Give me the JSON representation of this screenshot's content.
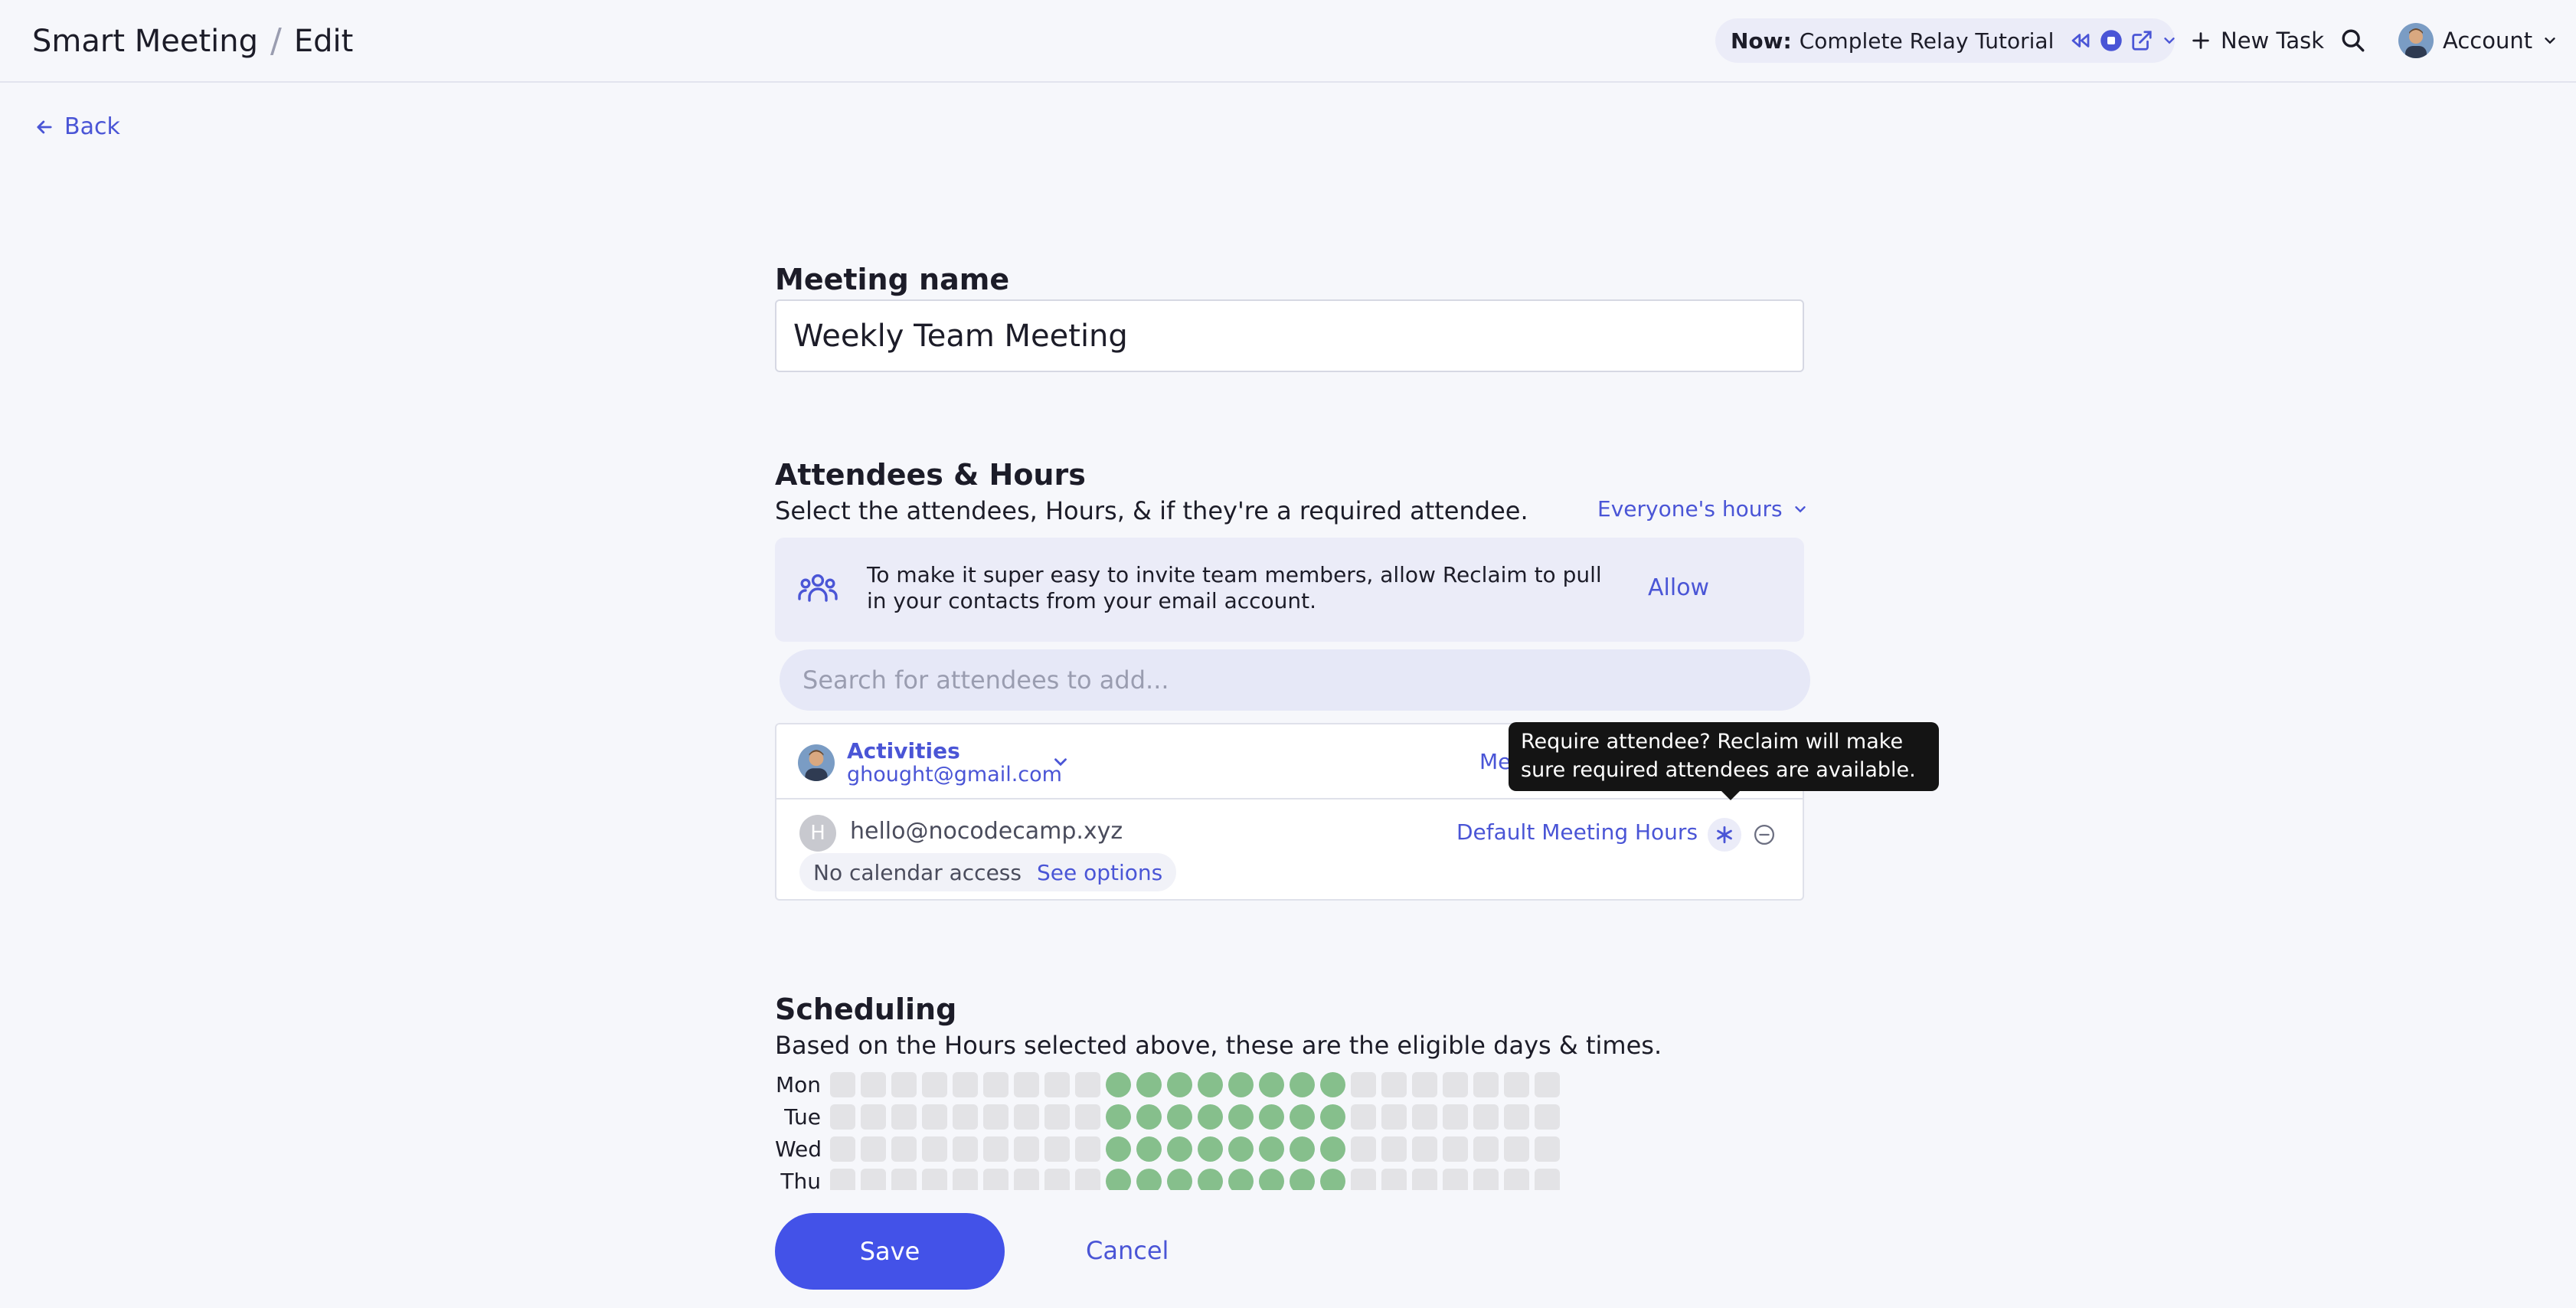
{
  "header": {
    "breadcrumb_app": "Smart Meeting",
    "breadcrumb_sep": "/",
    "breadcrumb_page": "Edit",
    "now_label": "Now:",
    "now_task": "Complete Relay Tutorial",
    "new_task_label": "New Task",
    "account_label": "Account"
  },
  "back_label": "Back",
  "meeting": {
    "name_label": "Meeting name",
    "name_value": "Weekly Team Meeting"
  },
  "attendees": {
    "title": "Attendees & Hours",
    "subtitle": "Select the attendees, Hours, & if they're a required attendee.",
    "hours_selector": "Everyone's hours",
    "banner_text": "To make it super easy to invite team members, allow Reclaim to pull in your contacts from your email account.",
    "banner_action": "Allow",
    "search_placeholder": "Search for attendees to add...",
    "owner": {
      "calendar": "Activities",
      "email": "ghought@gmail.com",
      "hours_partial": "Me"
    },
    "guest": {
      "initial": "H",
      "email": "hello@nocodecamp.xyz",
      "hours": "Default Meeting Hours",
      "no_access": "No calendar access",
      "see_options": "See options"
    },
    "tooltip": "Require attendee? Reclaim will make sure required attendees are available."
  },
  "scheduling": {
    "title": "Scheduling",
    "subtitle": "Based on the Hours selected above, these are the eligible days & times.",
    "days": [
      "Mon",
      "Tue",
      "Wed",
      "Thu"
    ],
    "slots_per_day": 24,
    "eligible_slots": [
      9,
      10,
      11,
      12,
      13,
      14,
      15,
      16
    ]
  },
  "actions": {
    "save": "Save",
    "cancel": "Cancel"
  },
  "colors": {
    "accent": "#4352e8",
    "link": "#4a55d6",
    "eligible": "#86bf8c",
    "ineligible": "#e3e3e6"
  }
}
